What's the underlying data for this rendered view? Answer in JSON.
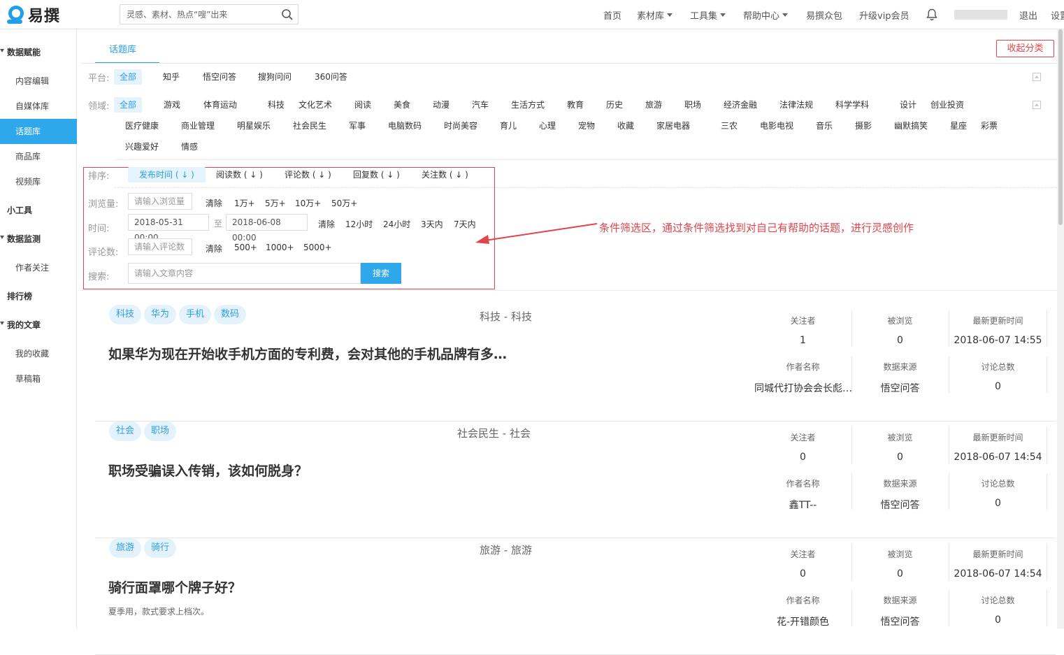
{
  "app": {
    "logo_text": "易撰"
  },
  "search": {
    "placeholder": "灵感、素材、热点“嗖”出来"
  },
  "topnav": {
    "home": "首页",
    "materials": "素材库",
    "tools": "工具集",
    "help": "帮助中心",
    "crowd": "易撰众包",
    "vip": "升级vip会员",
    "logout": "退出",
    "settings": "设置"
  },
  "sidebar": {
    "groups": {
      "data": "数据赋能",
      "tools": "小工具",
      "monitor": "数据监测",
      "rank": "排行榜",
      "articles": "我的文章"
    },
    "items": {
      "content_edit": "内容编辑",
      "media_lib": "自媒体库",
      "topic_lib": "话题库",
      "product_lib": "商品库",
      "video_lib": "视频库",
      "author_follow": "作者关注",
      "favorites": "我的收藏",
      "drafts": "草稿箱"
    }
  },
  "tab": {
    "title": "话题库",
    "collapse": "收起分类"
  },
  "filters": {
    "platform_label": "平台:",
    "platforms": [
      "全部",
      "知乎",
      "悟空问答",
      "搜狗问问",
      "360问答"
    ],
    "domain_label": "领域:",
    "domains_row1": [
      "全部",
      "游戏",
      "体育运动",
      "科技",
      "文化艺术",
      "阅读",
      "美食",
      "动漫",
      "汽车",
      "生活方式",
      "教育",
      "历史",
      "旅游",
      "职场",
      "经济金融",
      "法律法规",
      "科学学科",
      "设计",
      "创业投资"
    ],
    "domains_row2": [
      "医疗健康",
      "商业管理",
      "明星娱乐",
      "社会民生",
      "军事",
      "电脑数码",
      "时尚美容",
      "育儿",
      "心理",
      "宠物",
      "收藏",
      "家居电器",
      "三农",
      "电影电视",
      "音乐",
      "摄影",
      "幽默搞笑",
      "星座",
      "彩票"
    ],
    "domains_row3": [
      "兴趣爱好",
      "情感"
    ],
    "sort_label": "排序:",
    "sorts": [
      "发布时间 ( ↓ )",
      "阅读数 ( ↓ )",
      "评论数 ( ↓ )",
      "回复数 ( ↓ )",
      "关注数 ( ↓ )"
    ],
    "views_label": "浏览量:",
    "views_placeholder": "请输入浏览量",
    "views_options": [
      "清除",
      "1万+",
      "5万+",
      "10万+",
      "50万+"
    ],
    "time_label": "时间:",
    "time_from": "2018-05-31 00:00",
    "time_to_label": "至",
    "time_to": "2018-06-08 00:00",
    "time_options": [
      "清除",
      "12小时",
      "24小时",
      "3天内",
      "7天内"
    ],
    "comments_label": "评论数:",
    "comments_placeholder": "请输入评论数",
    "comments_options": [
      "清除",
      "500+",
      "1000+",
      "5000+"
    ],
    "search_label": "搜索:",
    "search_placeholder": "请输入文章内容",
    "search_button": "搜索"
  },
  "annotation": "条件筛选区，通过条件筛选找到对自己有帮助的话题，进行灵感创作",
  "stat_labels": {
    "followers": "关注者",
    "views": "被浏览",
    "updated": "最新更新时间",
    "author": "作者名称",
    "source": "数据来源",
    "discussions": "讨论总数"
  },
  "topics": [
    {
      "tags": [
        "科技",
        "华为",
        "手机",
        "数码"
      ],
      "category": "科技 - 科技",
      "title": "如果华为现在开始收手机方面的专利费，会对其他的手机品牌有多…",
      "desc": "",
      "followers": "1",
      "views": "0",
      "updated": "2018-06-07 14:55",
      "author": "同城代打协会会长彪…",
      "source": "悟空问答",
      "discussions": "0"
    },
    {
      "tags": [
        "社会",
        "职场"
      ],
      "category": "社会民生 - 社会",
      "title": "职场受骗误入传销，该如何脱身？",
      "desc": "",
      "followers": "0",
      "views": "0",
      "updated": "2018-06-07 14:54",
      "author": "鑫TT--",
      "source": "悟空问答",
      "discussions": "0"
    },
    {
      "tags": [
        "旅游",
        "骑行"
      ],
      "category": "旅游 - 旅游",
      "title": "骑行面罩哪个牌子好？",
      "desc": "夏季用，款式要求上档次。",
      "followers": "0",
      "views": "0",
      "updated": "2018-06-07 14:54",
      "author": "花-开错颜色",
      "source": "悟空问答",
      "discussions": "0"
    }
  ],
  "colors": {
    "accent": "#2ea8ea",
    "annotation": "#e0454b"
  }
}
